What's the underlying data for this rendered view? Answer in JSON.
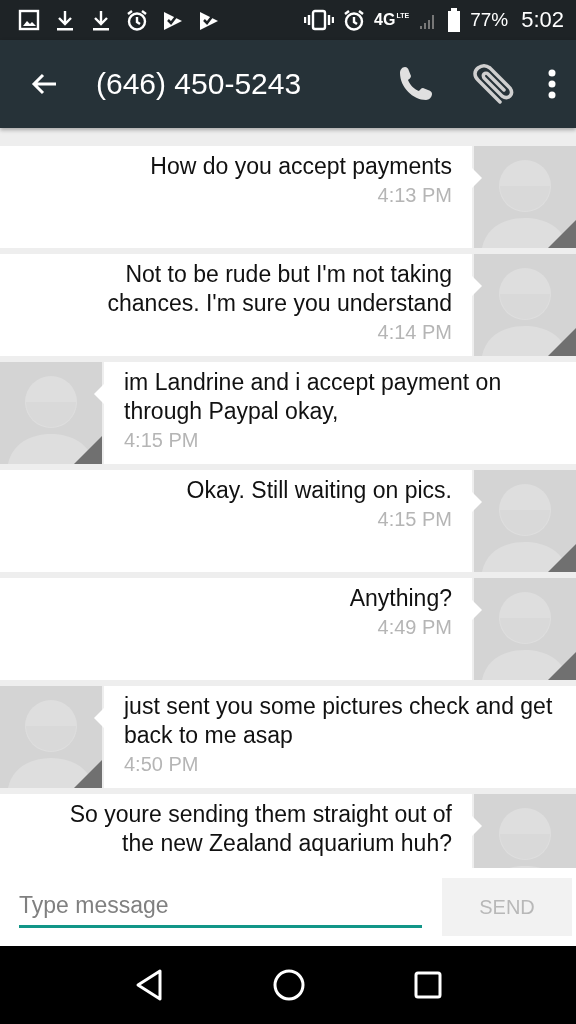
{
  "status_bar": {
    "network_type": "4G",
    "network_sub": "LTE",
    "battery": "77%",
    "time": "5:02"
  },
  "toolbar": {
    "title": "(646) 450-5243"
  },
  "messages": [
    {
      "kind": "outgoing",
      "text": "How do you accept payments",
      "time": "4:13 PM"
    },
    {
      "kind": "outgoing",
      "text": "Not to be rude but I'm not taking chances. I'm sure you understand",
      "time": "4:14 PM"
    },
    {
      "kind": "incoming",
      "text": "im Landrine and i accept payment on through Paypal okay,",
      "time": "4:15 PM"
    },
    {
      "kind": "outgoing",
      "text": "Okay. Still waiting on pics.",
      "time": "4:15 PM"
    },
    {
      "kind": "outgoing",
      "text": "Anything?",
      "time": "4:49 PM"
    },
    {
      "kind": "incoming",
      "text": "just sent you some pictures check and get back to me asap",
      "time": "4:50 PM"
    },
    {
      "kind": "outgoing",
      "text": "So youre sending them straight out of the new Zealand aquarium huh?"
    }
  ],
  "composer": {
    "placeholder": "Type message",
    "send_label": "SEND"
  }
}
